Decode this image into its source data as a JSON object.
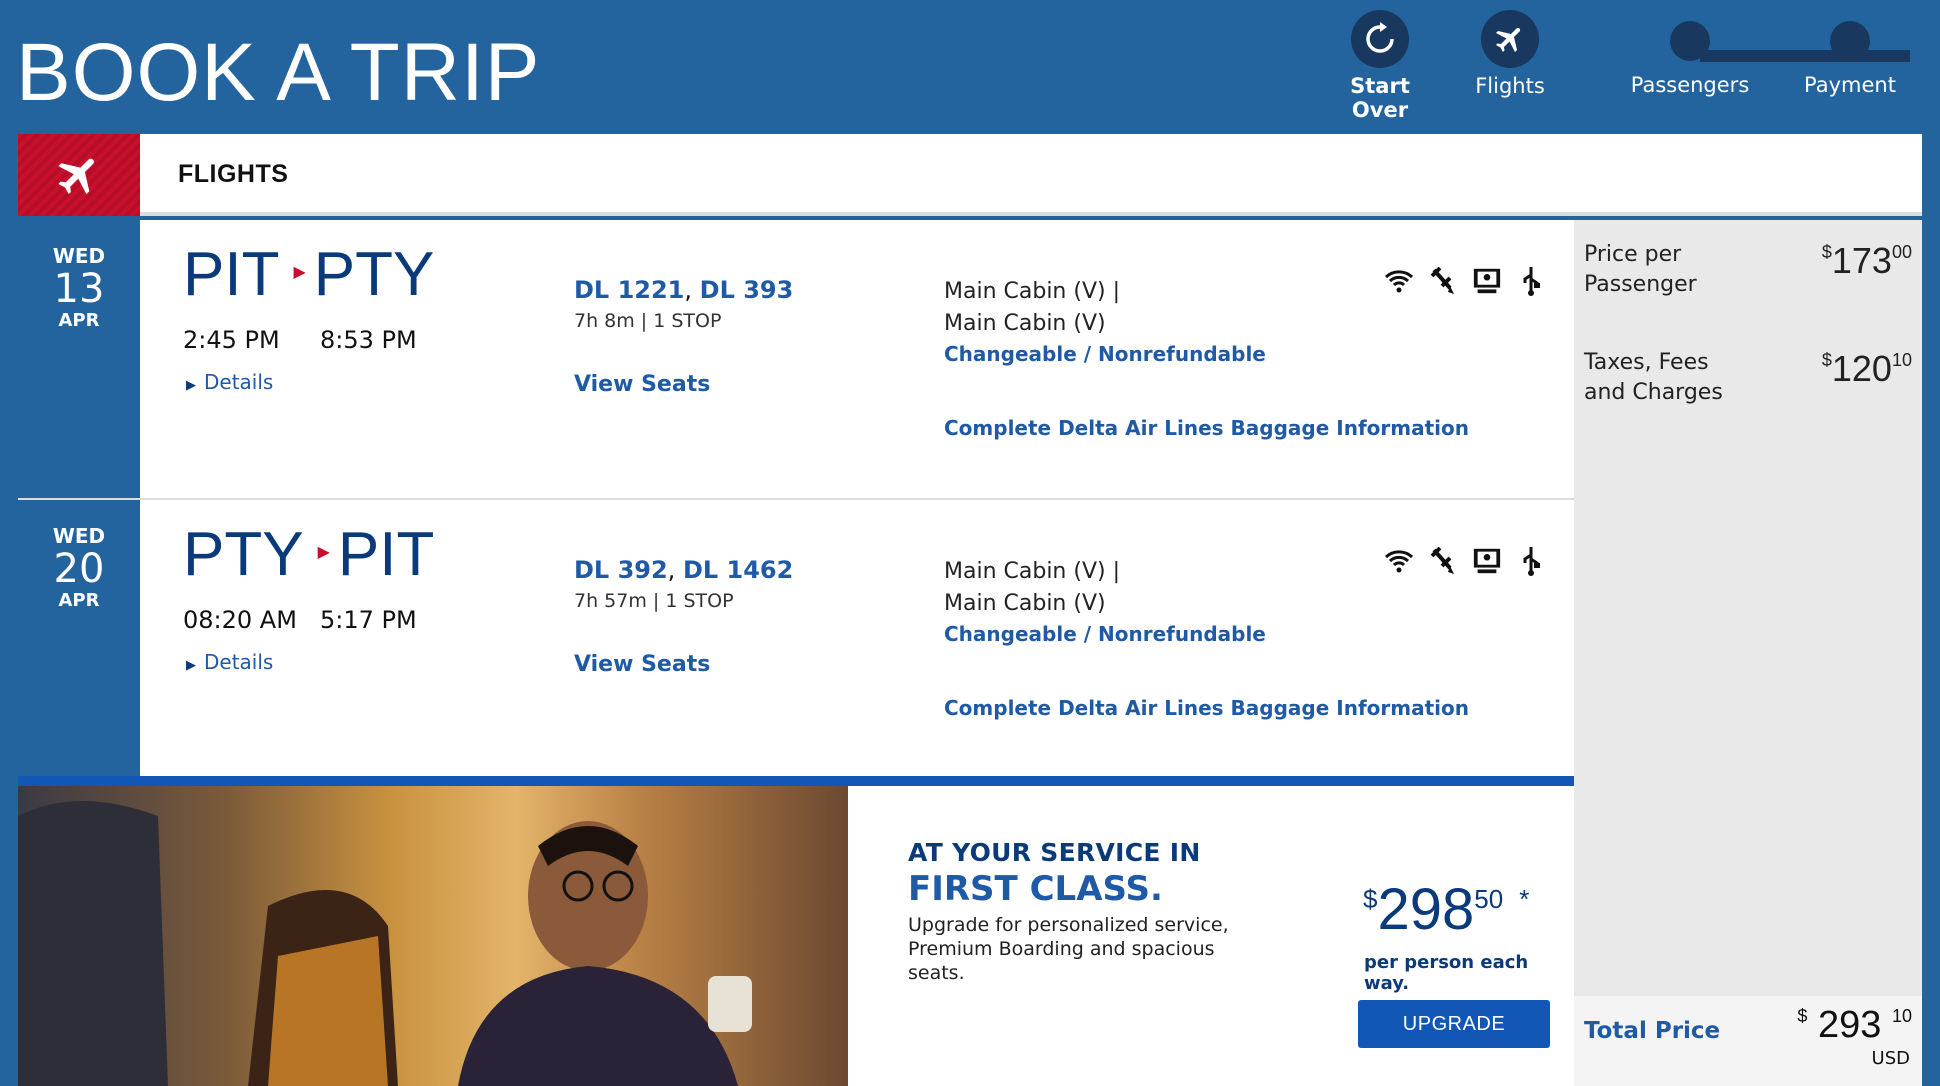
{
  "header": {
    "title": "BOOK A TRIP",
    "steps": {
      "start_over": "Start Over",
      "flights": "Flights",
      "passengers": "Passengers",
      "payment": "Payment"
    }
  },
  "flights_section": {
    "title": "FLIGHTS"
  },
  "segments": [
    {
      "dow": "WED",
      "day": "13",
      "month": "APR",
      "origin": "PIT",
      "destination": "PTY",
      "depart_time": "2:45 PM",
      "arrive_time": "8:53 PM",
      "details_label": "Details",
      "flight_1": "DL 1221",
      "flight_2": "DL 393",
      "duration": "7h 8m | 1 STOP",
      "view_seats": "View Seats",
      "cabin_1": "Main Cabin (V) |",
      "cabin_2": "Main Cabin (V)",
      "fare_rules": "Changeable / Nonrefundable",
      "baggage": "Complete Delta Air Lines Baggage Information",
      "amenities": [
        "wifi-icon",
        "satellite-icon",
        "video-screen-icon",
        "usb-icon"
      ]
    },
    {
      "dow": "WED",
      "day": "20",
      "month": "APR",
      "origin": "PTY",
      "destination": "PIT",
      "depart_time": "08:20 AM",
      "arrive_time": "5:17 PM",
      "details_label": "Details",
      "flight_1": "DL 392",
      "flight_2": "DL 1462",
      "duration": "7h 57m | 1 STOP",
      "view_seats": "View Seats",
      "cabin_1": "Main Cabin (V) |",
      "cabin_2": "Main Cabin (V)",
      "fare_rules": "Changeable / Nonrefundable",
      "baggage": "Complete Delta Air Lines Baggage Information",
      "amenities": [
        "wifi-icon",
        "satellite-icon",
        "video-screen-icon",
        "usb-icon"
      ]
    }
  ],
  "pricing": {
    "per_passenger_label_1": "Price per",
    "per_passenger_label_2": "Passenger",
    "per_passenger_currency": "$",
    "per_passenger_whole": "173",
    "per_passenger_cents": "00",
    "taxes_label_1": "Taxes, Fees",
    "taxes_label_2": "and Charges",
    "taxes_currency": "$",
    "taxes_whole": "120",
    "taxes_cents": "10",
    "total_label": "Total Price",
    "total_currency": "$",
    "total_whole": "293",
    "total_cents": "10",
    "total_unit": "USD"
  },
  "promo": {
    "kicker": "AT YOUR SERVICE IN",
    "headline": "FIRST CLASS.",
    "description": "Upgrade for personalized service, Premium Boarding and spacious seats.",
    "currency": "$",
    "price_whole": "298",
    "price_cents": "50",
    "asterisk": "*",
    "price_sub": "per person each way.",
    "button": "UPGRADE"
  },
  "colors": {
    "brand_blue": "#23649f",
    "accent_red": "#c8102e",
    "link_blue": "#1f5aa6",
    "button_blue": "#1256b6"
  }
}
